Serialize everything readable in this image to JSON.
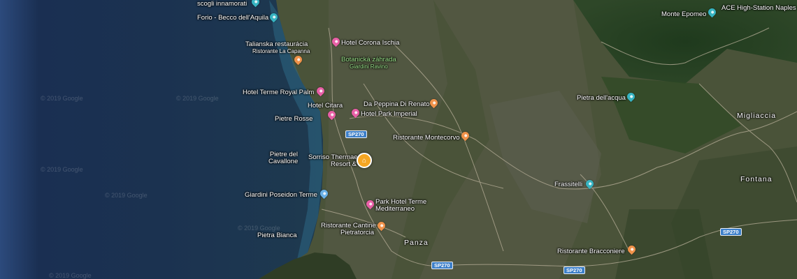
{
  "map": {
    "places": {
      "scogli": "scogli innamorati",
      "forio": "Forio - Becco dell'Aquila",
      "talianska": "Talianska restaurácia",
      "capanna": "Ristorante La Capanna",
      "corona": "Hotel Corona Ischia",
      "botanicka": "Botanická záhrada",
      "ravino": "Giardini Ravino",
      "royalpalm": "Hotel Terme Royal Palm",
      "citara": "Hotel Citara",
      "peppina": "Da Peppina Di Renato",
      "parkimperial": "Hotel Park Imperial",
      "pietrerosse": "Pietre Rosse",
      "montecorvo": "Ristorante Montecorvo",
      "cavallone_1": "Pietre del",
      "cavallone_2": "Cavallone",
      "sorriso_1": "Sorriso Thermae",
      "sorriso_2": "Resort &",
      "poseidon": "Giardini Poseidon Terme",
      "mediterraneo_1": "Park Hotel Terme",
      "mediterraneo_2": "Mediterraneo",
      "cantine_1": "Ristorante Cantine",
      "cantine_2": "Pietratorcia",
      "pietrabianca": "Pietra Bianca",
      "panza": "Panza",
      "epomeo": "Monte Epomeo",
      "ace": "ACE High-Station Naples",
      "pietraacqua": "Pietra dell'acqua",
      "migliaccia": "Migliaccia",
      "fontana": "Fontana",
      "frassitelli": "Frassitelli",
      "bracconiere": "Ristorante Bracconiere"
    },
    "roads": {
      "sp270_a": "SP270",
      "sp270_b": "SP270",
      "sp270_c": "SP270",
      "sp270_d": "SP270"
    },
    "watermark": "© 2019 Google",
    "colors": {
      "sea": "#1d3553",
      "land": "#48533a",
      "forest": "#233d22",
      "hotel_pin": "#e85fa6",
      "food_pin": "#f0924a",
      "attraction_pin": "#37b4c2",
      "home_marker": "#f5a623",
      "road_shield": "#3c7fc9"
    },
    "icons": {
      "hotel": "bed-icon",
      "restaurant": "fork-knife-icon",
      "attraction": "camera-icon",
      "home": "home-icon"
    }
  }
}
